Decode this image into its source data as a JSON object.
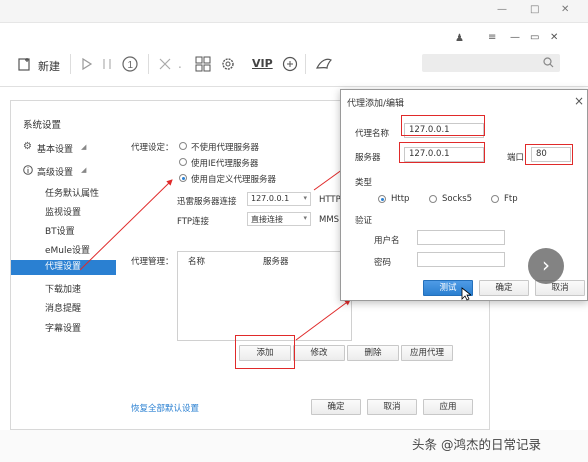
{
  "window": {
    "controls": [
      "—",
      "□",
      "✕"
    ]
  },
  "toolbar": {
    "new_label": "新建",
    "vip_label": "VIP"
  },
  "sidebar": {
    "items": [
      {
        "label": "系统设置"
      },
      {
        "label": "基本设置"
      },
      {
        "label": "高级设置"
      },
      {
        "label": "任务默认属性"
      },
      {
        "label": "监视设置"
      },
      {
        "label": "BT设置"
      },
      {
        "label": "eMule设置"
      },
      {
        "label": "代理设置"
      },
      {
        "label": "下载加速"
      },
      {
        "label": "消息提醒"
      },
      {
        "label": "字幕设置"
      }
    ]
  },
  "proxy_settings": {
    "label": "代理设定：",
    "options": [
      "不使用代理服务器",
      "使用IE代理服务器",
      "使用自定义代理服务器"
    ],
    "xunlei_label": "迅雷服务器连接",
    "xunlei_value": "127.0.0.1",
    "http_label": "HTTP",
    "ftp_label": "FTP连接",
    "ftp_value": "直接连接",
    "mms_label": "MMS"
  },
  "proxy_manage": {
    "label": "代理管理：",
    "columns": [
      "名称",
      "服务器"
    ],
    "add": "添加",
    "edit": "修改",
    "delete": "删除",
    "apply": "应用代理"
  },
  "footer": {
    "restore": "恢复全部默认设置",
    "ok": "确定",
    "cancel": "取消",
    "apply": "应用"
  },
  "proxy_dialog": {
    "title": "代理添加/编辑",
    "close": "×",
    "name_label": "代理名称",
    "name_value": "127.0.0.1",
    "server_label": "服务器",
    "server_value": "127.0.0.1",
    "port_label": "端口",
    "port_value": "80",
    "type_label": "类型",
    "types": [
      "Http",
      "Socks5",
      "Ftp"
    ],
    "auth_label": "验证",
    "user_label": "用户名",
    "pass_label": "密码",
    "test": "测试",
    "ok": "确定",
    "cancel": "取消"
  },
  "watermark": "头条 @鸿杰的日常记录",
  "colors": {
    "accent": "#2a80d2",
    "annotation": "#e02a2a"
  }
}
